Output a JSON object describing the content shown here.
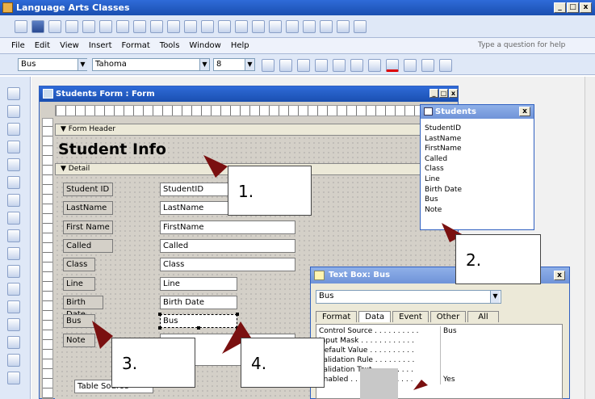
{
  "window": {
    "title": "Language Arts Classes"
  },
  "menu": {
    "items": [
      "File",
      "Edit",
      "View",
      "Insert",
      "Format",
      "Tools",
      "Window",
      "Help"
    ],
    "question": "Type a question for help"
  },
  "format_bar": {
    "object": "Bus",
    "font": "Tahoma",
    "size": "8"
  },
  "form": {
    "title": "Students Form : Form",
    "form_header_label": "Form Header",
    "heading": "Student Info",
    "detail_label": "Detail",
    "fields": [
      {
        "label": "Student ID",
        "control": "StudentID"
      },
      {
        "label": "LastName",
        "control": "LastName"
      },
      {
        "label": "First Name",
        "control": "FirstName"
      },
      {
        "label": "Called",
        "control": "Called"
      },
      {
        "label": "Class",
        "control": "Class"
      },
      {
        "label": "Line",
        "control": "Line"
      },
      {
        "label": "Birth Date",
        "control": "Birth Date"
      },
      {
        "label": "Bus",
        "control": "Bus"
      },
      {
        "label": "Note",
        "control": ""
      }
    ],
    "table_label": "Table Source"
  },
  "field_list": {
    "title": "Students",
    "items": [
      "StudentID",
      "LastName",
      "FirstName",
      "Called",
      "Class",
      "Line",
      "Birth Date",
      "Bus",
      "Note"
    ]
  },
  "properties": {
    "title": "Text Box: Bus",
    "selector": "Bus",
    "tabs": [
      "Format",
      "Data",
      "Event",
      "Other",
      "All"
    ],
    "rows": [
      {
        "name": "Control Source . . . . . . . . . .",
        "value": "Bus"
      },
      {
        "name": "Input Mask . . . . . . . . . . . .",
        "value": ""
      },
      {
        "name": "Default Value . . . . . . . . . .",
        "value": ""
      },
      {
        "name": "Validation Rule . . . . . . . . .",
        "value": ""
      },
      {
        "name": "Validation Text . . . . . . . . .",
        "value": ""
      },
      {
        "name": "Enabled . . . . . . . . . . . . . .",
        "value": "Yes"
      }
    ]
  },
  "callouts": [
    "1.",
    "2.",
    "3.",
    "4."
  ]
}
